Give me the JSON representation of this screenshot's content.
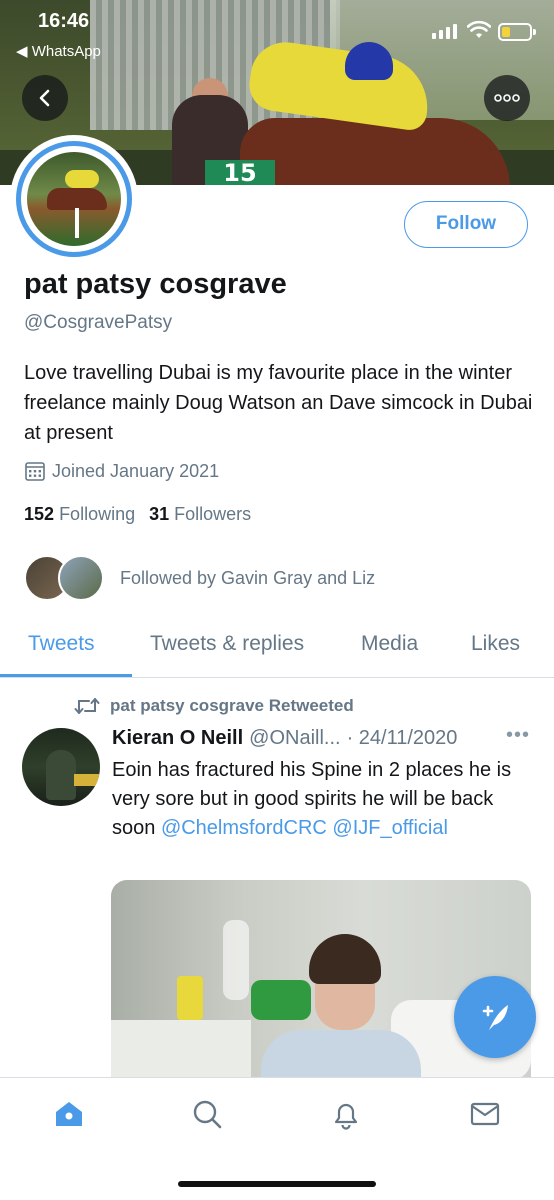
{
  "status_bar": {
    "time": "16:46",
    "back_app": "◀ WhatsApp"
  },
  "profile": {
    "name": "pat patsy cosgrave",
    "handle": "@CosgravePatsy",
    "bio": "Love travelling Dubai is my favourite place in the winter freelance mainly Doug Watson an Dave simcock in Dubai at present",
    "joined": "Joined January 2021",
    "following_count": "152",
    "following_label": "Following",
    "followers_count": "31",
    "followers_label": "Followers",
    "followed_by": "Followed by Gavin Gray and Liz",
    "follow_button": "Follow",
    "banner_saddle_cloth": "15"
  },
  "tabs": [
    {
      "label": "Tweets",
      "active": true
    },
    {
      "label": "Tweets & replies",
      "active": false
    },
    {
      "label": "Media",
      "active": false
    },
    {
      "label": "Likes",
      "active": false
    }
  ],
  "tweet": {
    "retweet_label": "pat patsy cosgrave Retweeted",
    "author": "Kieran O Neill",
    "handle": "@ONaill...",
    "date": "· 24/11/2020",
    "more": "•••",
    "text": "Eoin has fractured his Spine in 2 places he is very sore but in good spirits he will be back soon",
    "mention_1": "@ChelmsfordCRC",
    "mention_2": "@IJF_official"
  },
  "bottom_nav": [
    "home-icon",
    "search-icon",
    "notifications-icon",
    "messages-icon"
  ],
  "colors": {
    "accent": "#4a9ae8",
    "secondary_text": "#657786",
    "primary_text": "#14171a"
  }
}
